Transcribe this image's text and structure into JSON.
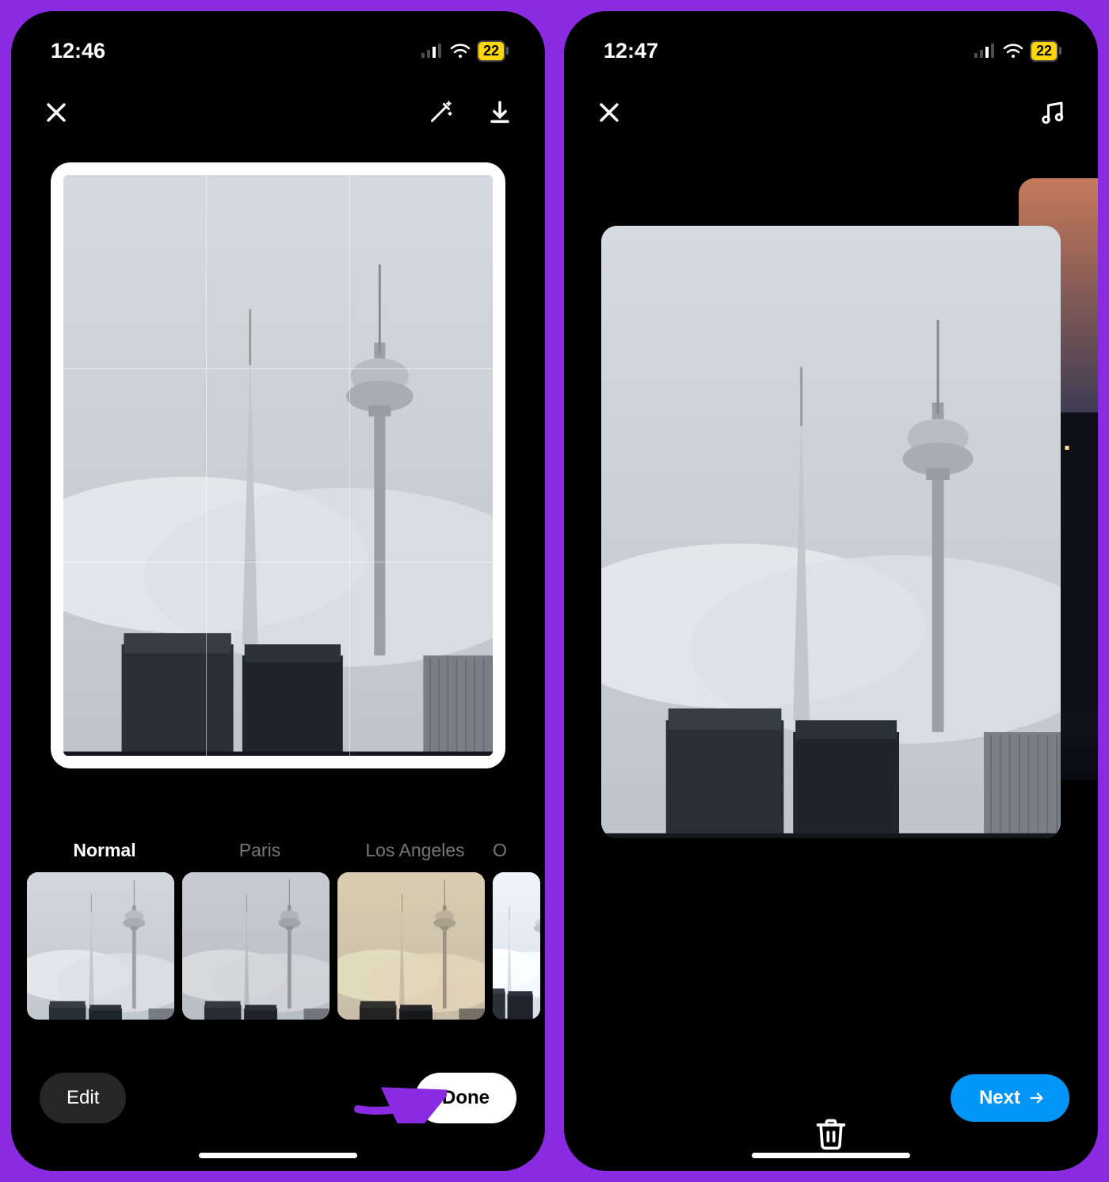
{
  "leftScreen": {
    "status": {
      "time": "12:46",
      "battery": "22"
    },
    "filters": [
      "Normal",
      "Paris",
      "Los Angeles",
      "O"
    ],
    "editLabel": "Edit",
    "doneLabel": "Done"
  },
  "rightScreen": {
    "status": {
      "time": "12:47",
      "battery": "22"
    },
    "nextLabel": "Next"
  }
}
